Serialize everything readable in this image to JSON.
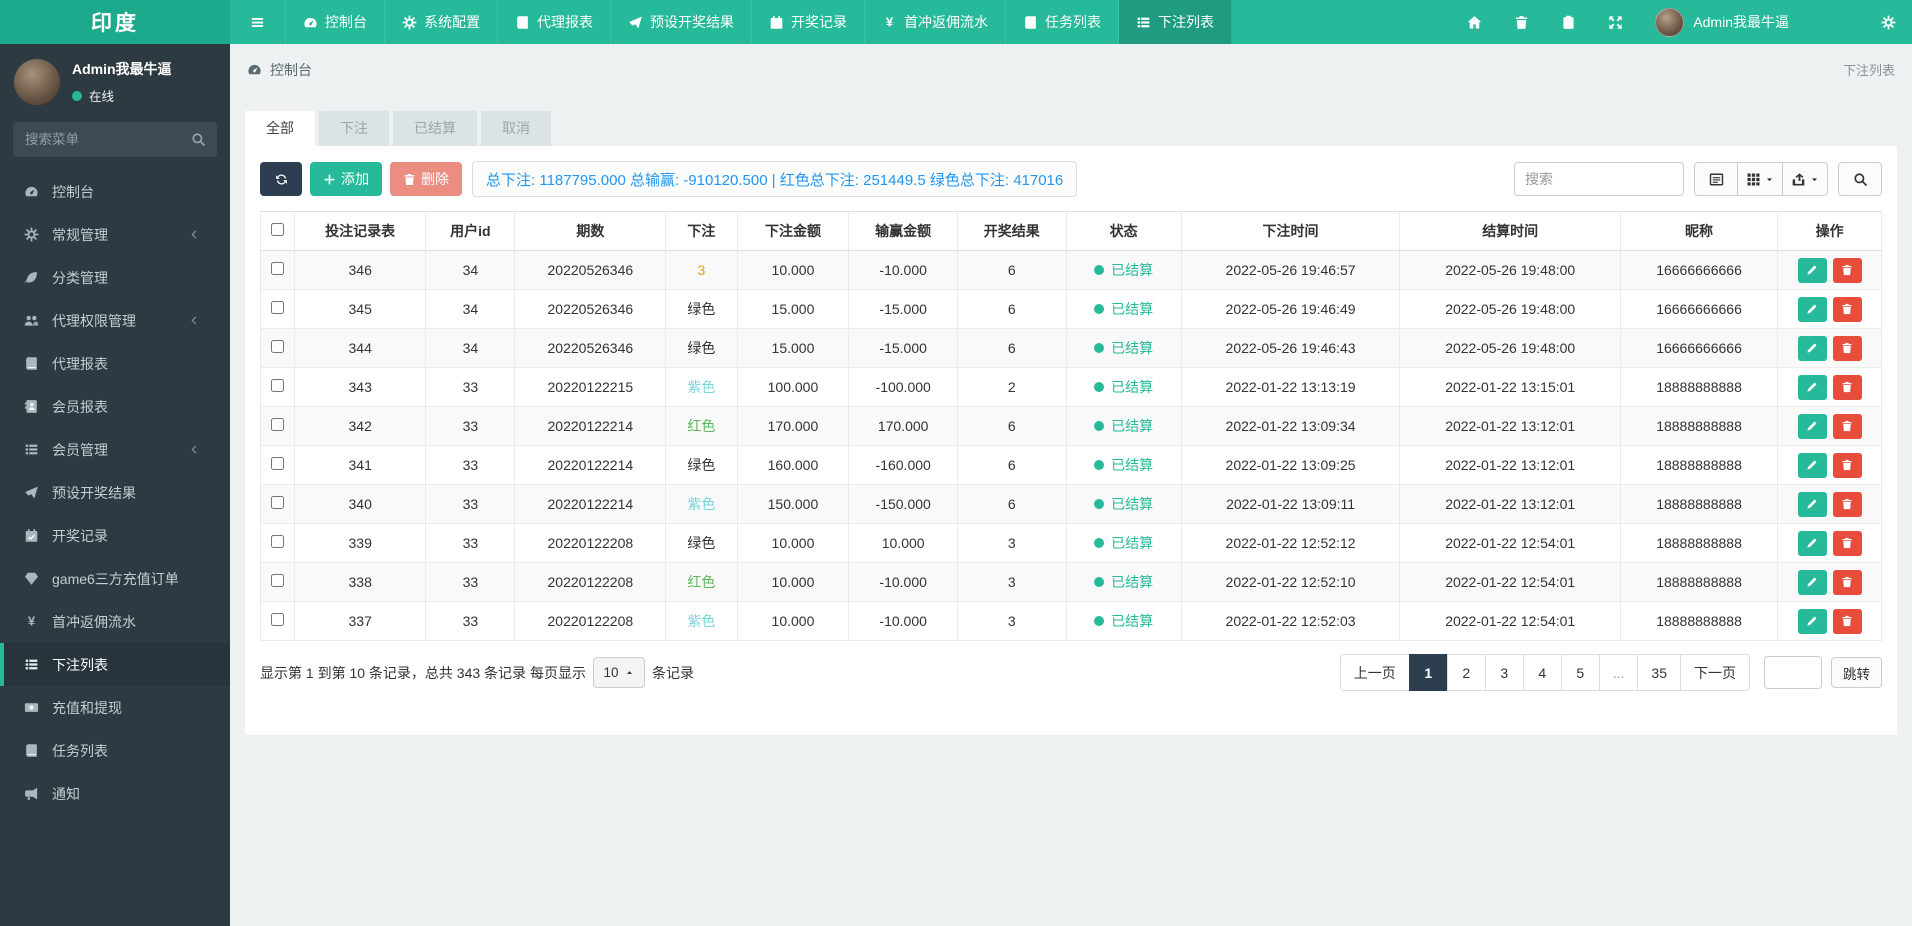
{
  "brand": "印度",
  "navbar": {
    "items": [
      {
        "label": "控制台",
        "icon": "dashboard",
        "active": false
      },
      {
        "label": "系统配置",
        "icon": "gear",
        "active": false
      },
      {
        "label": "代理报表",
        "icon": "book",
        "active": false
      },
      {
        "label": "预设开奖结果",
        "icon": "send",
        "active": false
      },
      {
        "label": "开奖记录",
        "icon": "calendar",
        "active": false
      },
      {
        "label": "首冲返佣流水",
        "icon": "yen",
        "active": false
      },
      {
        "label": "任务列表",
        "icon": "book",
        "active": false
      },
      {
        "label": "下注列表",
        "icon": "list",
        "active": true
      }
    ],
    "username": "Admin我最牛逼"
  },
  "sidebar": {
    "username": "Admin我最牛逼",
    "status": "在线",
    "search_placeholder": "搜索菜单",
    "items": [
      {
        "label": "控制台",
        "icon": "dashboard",
        "expandable": false,
        "active": false
      },
      {
        "label": "常规管理",
        "icon": "cogs",
        "expandable": true,
        "active": false
      },
      {
        "label": "分类管理",
        "icon": "leaf",
        "expandable": false,
        "active": false
      },
      {
        "label": "代理权限管理",
        "icon": "users",
        "expandable": true,
        "active": false
      },
      {
        "label": "代理报表",
        "icon": "book",
        "expandable": false,
        "active": false
      },
      {
        "label": "会员报表",
        "icon": "address-book",
        "expandable": false,
        "active": false
      },
      {
        "label": "会员管理",
        "icon": "list",
        "expandable": true,
        "active": false
      },
      {
        "label": "预设开奖结果",
        "icon": "send",
        "expandable": false,
        "active": false
      },
      {
        "label": "开奖记录",
        "icon": "calendar",
        "expandable": false,
        "active": false
      },
      {
        "label": "game6三方充值订单",
        "icon": "gem",
        "expandable": false,
        "active": false
      },
      {
        "label": "首冲返佣流水",
        "icon": "yen",
        "expandable": false,
        "active": false
      },
      {
        "label": "下注列表",
        "icon": "list",
        "expandable": false,
        "active": true
      },
      {
        "label": "充值和提现",
        "icon": "money",
        "expandable": false,
        "active": false
      },
      {
        "label": "任务列表",
        "icon": "book",
        "expandable": false,
        "active": false
      },
      {
        "label": "通知",
        "icon": "bullhorn",
        "expandable": false,
        "active": false
      }
    ]
  },
  "breadcrumb": "控制台",
  "page_title": "下注列表",
  "tabs": [
    {
      "label": "全部",
      "active": true
    },
    {
      "label": "下注",
      "active": false
    },
    {
      "label": "已结算",
      "active": false
    },
    {
      "label": "取消",
      "active": false
    }
  ],
  "toolbar": {
    "add_label": "添加",
    "delete_label": "删除",
    "summary": "总下注: 1187795.000 总输赢: -910120.500 | 红色总下注: 251449.5 绿色总下注: 417016",
    "search_placeholder": "搜索"
  },
  "table": {
    "headers": [
      "投注记录表",
      "用户id",
      "期数",
      "下注",
      "下注金额",
      "输赢金额",
      "开奖结果",
      "状态",
      "下注时间",
      "结算时间",
      "昵称",
      "操作"
    ],
    "status_colors": {
      "已结算": "#26b99a"
    },
    "bet_colors": {
      "orange": "#f39c12",
      "dark": "#333333",
      "cyan": "#7bd6da",
      "green": "#5cb85c"
    },
    "rows": [
      {
        "record_id": "346",
        "user_id": "34",
        "period": "20220526346",
        "bet": "3",
        "bet_color": "orange",
        "bet_amount": "10.000",
        "win_loss": "-10.000",
        "result": "6",
        "status": "已结算",
        "bet_time": "2022-05-26 19:46:57",
        "settle_time": "2022-05-26 19:48:00",
        "nickname": "16666666666"
      },
      {
        "record_id": "345",
        "user_id": "34",
        "period": "20220526346",
        "bet": "绿色",
        "bet_color": "dark",
        "bet_amount": "15.000",
        "win_loss": "-15.000",
        "result": "6",
        "status": "已结算",
        "bet_time": "2022-05-26 19:46:49",
        "settle_time": "2022-05-26 19:48:00",
        "nickname": "16666666666"
      },
      {
        "record_id": "344",
        "user_id": "34",
        "period": "20220526346",
        "bet": "绿色",
        "bet_color": "dark",
        "bet_amount": "15.000",
        "win_loss": "-15.000",
        "result": "6",
        "status": "已结算",
        "bet_time": "2022-05-26 19:46:43",
        "settle_time": "2022-05-26 19:48:00",
        "nickname": "16666666666"
      },
      {
        "record_id": "343",
        "user_id": "33",
        "period": "20220122215",
        "bet": "紫色",
        "bet_color": "cyan",
        "bet_amount": "100.000",
        "win_loss": "-100.000",
        "result": "2",
        "status": "已结算",
        "bet_time": "2022-01-22 13:13:19",
        "settle_time": "2022-01-22 13:15:01",
        "nickname": "18888888888"
      },
      {
        "record_id": "342",
        "user_id": "33",
        "period": "20220122214",
        "bet": "红色",
        "bet_color": "green",
        "bet_amount": "170.000",
        "win_loss": "170.000",
        "result": "6",
        "status": "已结算",
        "bet_time": "2022-01-22 13:09:34",
        "settle_time": "2022-01-22 13:12:01",
        "nickname": "18888888888"
      },
      {
        "record_id": "341",
        "user_id": "33",
        "period": "20220122214",
        "bet": "绿色",
        "bet_color": "dark",
        "bet_amount": "160.000",
        "win_loss": "-160.000",
        "result": "6",
        "status": "已结算",
        "bet_time": "2022-01-22 13:09:25",
        "settle_time": "2022-01-22 13:12:01",
        "nickname": "18888888888"
      },
      {
        "record_id": "340",
        "user_id": "33",
        "period": "20220122214",
        "bet": "紫色",
        "bet_color": "cyan",
        "bet_amount": "150.000",
        "win_loss": "-150.000",
        "result": "6",
        "status": "已结算",
        "bet_time": "2022-01-22 13:09:11",
        "settle_time": "2022-01-22 13:12:01",
        "nickname": "18888888888"
      },
      {
        "record_id": "339",
        "user_id": "33",
        "period": "20220122208",
        "bet": "绿色",
        "bet_color": "dark",
        "bet_amount": "10.000",
        "win_loss": "10.000",
        "result": "3",
        "status": "已结算",
        "bet_time": "2022-01-22 12:52:12",
        "settle_time": "2022-01-22 12:54:01",
        "nickname": "18888888888"
      },
      {
        "record_id": "338",
        "user_id": "33",
        "period": "20220122208",
        "bet": "红色",
        "bet_color": "green",
        "bet_amount": "10.000",
        "win_loss": "-10.000",
        "result": "3",
        "status": "已结算",
        "bet_time": "2022-01-22 12:52:10",
        "settle_time": "2022-01-22 12:54:01",
        "nickname": "18888888888"
      },
      {
        "record_id": "337",
        "user_id": "33",
        "period": "20220122208",
        "bet": "紫色",
        "bet_color": "cyan",
        "bet_amount": "10.000",
        "win_loss": "-10.000",
        "result": "3",
        "status": "已结算",
        "bet_time": "2022-01-22 12:52:03",
        "settle_time": "2022-01-22 12:54:01",
        "nickname": "18888888888"
      }
    ]
  },
  "footer": {
    "info_prefix": "显示第 1 到第 10 条记录，总共 343 条记录 每页显示",
    "page_size": "10",
    "info_suffix": "条记录",
    "pages": [
      "上一页",
      "1",
      "2",
      "3",
      "4",
      "5",
      "...",
      "35",
      "下一页"
    ],
    "active_page": "1",
    "jump_label": "跳转"
  },
  "colors": {
    "accent": "#26b99a",
    "sidebar_bg": "#2e3a41",
    "pagination_active": "#2c3e50",
    "summary_text": "#2196f3",
    "delete_button": "#ec8d82",
    "row_delete": "#e74c3c"
  }
}
